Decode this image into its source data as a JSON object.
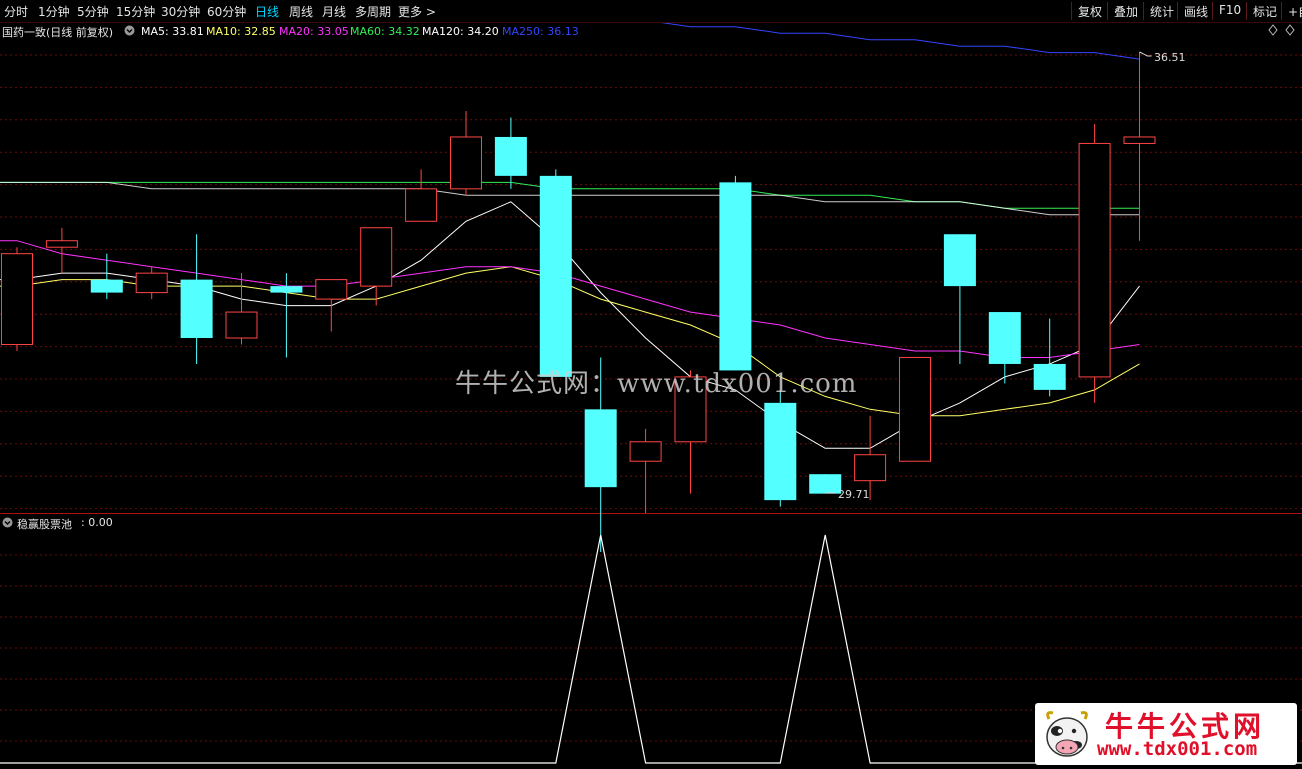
{
  "toolbar": {
    "periods": [
      "分时",
      "1分钟",
      "5分钟",
      "15分钟",
      "30分钟",
      "60分钟",
      "日线",
      "周线",
      "月线",
      "多周期",
      "更多 >"
    ],
    "active_period": "日线",
    "right_buttons": [
      "复权",
      "叠加",
      "统计",
      "画线",
      "F10",
      "标记",
      "+自"
    ]
  },
  "info_bar": {
    "title": "国药一致(日线 前复权)",
    "ma": [
      {
        "label": "MA5: 33.81",
        "color": "#ffffff"
      },
      {
        "label": "MA10: 32.85",
        "color": "#ffff66"
      },
      {
        "label": "MA20: 33.05",
        "color": "#ff33ff"
      },
      {
        "label": "MA60: 34.32",
        "color": "#33ee55"
      },
      {
        "label": "MA120: 34.20",
        "color": "#ffffff"
      },
      {
        "label": "MA250: 36.13",
        "color": "#3344ff"
      }
    ]
  },
  "price_labels": {
    "high": "36.51",
    "low": "29.71"
  },
  "indicator": {
    "name": "稳赢股票池",
    "value": ": 0.00"
  },
  "watermark": "牛牛公式网：www.tdx001.com",
  "logo": {
    "title": "牛牛公式网",
    "url": "www.tdx001.com"
  },
  "colors": {
    "up": "#ff4545",
    "down": "#54ffff",
    "grid": "#6a0d0d",
    "axis": "#b01010"
  },
  "chart_data": {
    "type": "candlestick",
    "candles": [
      {
        "o": 32.0,
        "h": 33.5,
        "l": 31.9,
        "c": 33.4
      },
      {
        "o": 33.5,
        "h": 33.8,
        "l": 33.1,
        "c": 33.6
      },
      {
        "o": 33.0,
        "h": 33.4,
        "l": 32.7,
        "c": 32.8
      },
      {
        "o": 32.8,
        "h": 33.2,
        "l": 32.7,
        "c": 33.1
      },
      {
        "o": 33.0,
        "h": 33.7,
        "l": 31.7,
        "c": 32.1
      },
      {
        "o": 32.1,
        "h": 33.1,
        "l": 32.0,
        "c": 32.5
      },
      {
        "o": 32.9,
        "h": 33.1,
        "l": 31.8,
        "c": 32.8
      },
      {
        "o": 32.7,
        "h": 33.0,
        "l": 32.2,
        "c": 33.0
      },
      {
        "o": 32.9,
        "h": 33.8,
        "l": 32.6,
        "c": 33.8
      },
      {
        "o": 33.9,
        "h": 34.7,
        "l": 33.9,
        "c": 34.4
      },
      {
        "o": 34.4,
        "h": 35.6,
        "l": 34.3,
        "c": 35.2
      },
      {
        "o": 35.2,
        "h": 35.5,
        "l": 34.4,
        "c": 34.6
      },
      {
        "o": 34.6,
        "h": 34.7,
        "l": 31.5,
        "c": 31.5
      },
      {
        "o": 31.0,
        "h": 31.8,
        "l": 28.8,
        "c": 29.8
      },
      {
        "o": 30.2,
        "h": 30.7,
        "l": 29.4,
        "c": 30.5
      },
      {
        "o": 30.5,
        "h": 31.6,
        "l": 29.7,
        "c": 31.5
      },
      {
        "o": 34.5,
        "h": 34.6,
        "l": 31.6,
        "c": 31.6
      },
      {
        "o": 31.1,
        "h": 31.3,
        "l": 29.5,
        "c": 29.6
      },
      {
        "o": 30.0,
        "h": 30.0,
        "l": 29.71,
        "c": 29.7
      },
      {
        "o": 29.9,
        "h": 30.9,
        "l": 29.6,
        "c": 30.3
      },
      {
        "o": 30.2,
        "h": 31.8,
        "l": 30.2,
        "c": 31.8
      },
      {
        "o": 33.7,
        "h": 33.7,
        "l": 31.7,
        "c": 32.9
      },
      {
        "o": 32.5,
        "h": 32.5,
        "l": 31.4,
        "c": 31.7
      },
      {
        "o": 31.7,
        "h": 32.4,
        "l": 31.2,
        "c": 31.3
      },
      {
        "o": 31.5,
        "h": 35.4,
        "l": 31.1,
        "c": 35.1
      },
      {
        "o": 35.1,
        "h": 36.51,
        "l": 33.6,
        "c": 35.2
      }
    ],
    "ma_series": {
      "MA5": [
        33.0,
        33.1,
        33.1,
        33.0,
        32.9,
        32.7,
        32.6,
        32.6,
        32.9,
        33.3,
        33.9,
        34.2,
        33.6,
        32.8,
        32.1,
        31.5,
        31.3,
        30.8,
        30.4,
        30.4,
        30.8,
        31.1,
        31.5,
        31.7,
        32.0,
        32.9
      ],
      "MA10": [
        32.9,
        33.0,
        33.0,
        32.9,
        32.9,
        32.9,
        32.8,
        32.7,
        32.7,
        32.9,
        33.1,
        33.2,
        33.0,
        32.7,
        32.5,
        32.3,
        32.0,
        31.5,
        31.2,
        31.0,
        30.9,
        30.9,
        31.0,
        31.1,
        31.3,
        31.7
      ],
      "MA20": [
        33.6,
        33.4,
        33.3,
        33.2,
        33.1,
        33.0,
        32.9,
        32.9,
        33.0,
        33.1,
        33.2,
        33.2,
        33.1,
        32.9,
        32.7,
        32.5,
        32.4,
        32.3,
        32.1,
        32.0,
        31.9,
        31.9,
        31.8,
        31.8,
        31.9,
        32.0
      ],
      "MA60": [
        34.5,
        34.5,
        34.5,
        34.5,
        34.5,
        34.5,
        34.5,
        34.5,
        34.5,
        34.5,
        34.5,
        34.5,
        34.4,
        34.4,
        34.4,
        34.4,
        34.4,
        34.3,
        34.3,
        34.3,
        34.2,
        34.2,
        34.1,
        34.1,
        34.1,
        34.1
      ],
      "MA120": [
        34.5,
        34.5,
        34.5,
        34.4,
        34.4,
        34.4,
        34.4,
        34.4,
        34.4,
        34.4,
        34.3,
        34.3,
        34.3,
        34.3,
        34.3,
        34.3,
        34.3,
        34.3,
        34.2,
        34.2,
        34.2,
        34.2,
        34.1,
        34.0,
        34.0,
        34.0
      ],
      "MA250": [
        37.6,
        37.6,
        37.5,
        37.5,
        37.4,
        37.4,
        37.4,
        37.3,
        37.3,
        37.2,
        37.2,
        37.1,
        37.1,
        37.0,
        37.0,
        36.9,
        36.9,
        36.8,
        36.8,
        36.7,
        36.7,
        36.6,
        36.6,
        36.5,
        36.5,
        36.4
      ]
    },
    "indicator_values": [
      0,
      0,
      0,
      0,
      0,
      0,
      0,
      0,
      0,
      0,
      0,
      0,
      0,
      1,
      0,
      0,
      0,
      0,
      1,
      0,
      0,
      0,
      0,
      0,
      0,
      0
    ]
  }
}
